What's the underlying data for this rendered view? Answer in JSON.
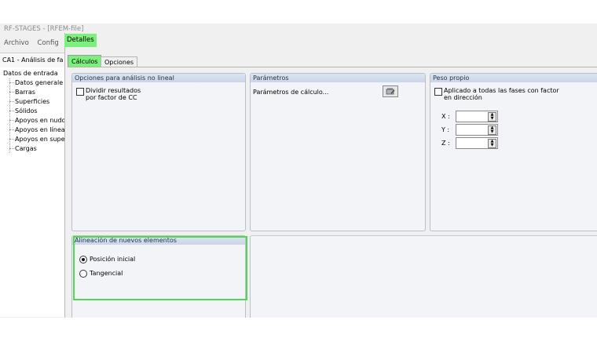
{
  "app": {
    "title": "RF-STAGES - [RFEM-file]",
    "menu": [
      "Archivo",
      "Config"
    ]
  },
  "case_label": "CA1 - Análisis de fa",
  "tree": {
    "root": "Datos de entrada",
    "items": [
      "Datos generale",
      "Barras",
      "Superficies",
      "Sólidos",
      "Apoyos en nudo",
      "Apoyos en línea",
      "Apoyos en supe",
      "Cargas"
    ]
  },
  "dialog": {
    "title": "Detalles",
    "tabs": [
      "Cálculos",
      "Opciones"
    ],
    "active_tab": "Cálculos"
  },
  "nonlinear": {
    "header": "Opciones para análisis no lineal",
    "checkbox_label_line1": "Dividir resultados",
    "checkbox_label_line2": "por factor de CC",
    "checked": false
  },
  "parameters": {
    "header": "Parámetros",
    "label": "Parámetros de cálculo...",
    "button_icon": "edit-icon"
  },
  "self_weight": {
    "header": "Peso propio",
    "checkbox_label_line1": "Aplicado a todas las fases con factor",
    "checkbox_label_line2": "en dirección",
    "checked": false,
    "fields": [
      {
        "label": "X :",
        "value": ""
      },
      {
        "label": "Y :",
        "value": ""
      },
      {
        "label": "Z :",
        "value": ""
      }
    ]
  },
  "alignment": {
    "header": "Alineación de nuevos elementos",
    "options": [
      "Posición inicial",
      "Tangencial"
    ],
    "selected": "Posición inicial"
  },
  "colors": {
    "highlight": "#7cf07c",
    "frame": "#53d653",
    "group_header": "#c9d6e8"
  }
}
